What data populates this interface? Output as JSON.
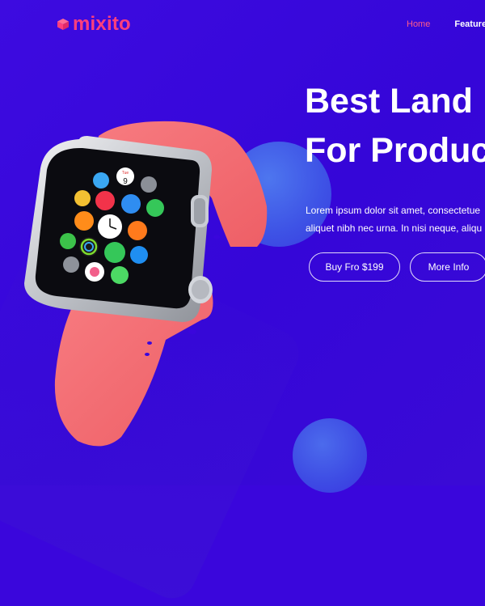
{
  "brand": {
    "name": "mixito",
    "color": "#ff3f7c"
  },
  "nav": {
    "items": [
      "Home",
      "Feature"
    ],
    "active": "Home"
  },
  "hero": {
    "title_line1": "Best Land",
    "title_line2": "For Produc",
    "text_line1": "Lorem ipsum dolor sit amet, consectetue",
    "text_line2": "aliquet nibh nec urna. In nisi neque, aliqu"
  },
  "buttons": {
    "buy_label": "Buy Fro $199",
    "more_label": "More Info"
  },
  "watch": {
    "calendar_day": "Tue",
    "calendar_date": "9"
  },
  "colors": {
    "background": "#3a06dc",
    "band": "#f26a72",
    "accent": "#ff5c8a",
    "bubble": "#4f7cf0"
  }
}
